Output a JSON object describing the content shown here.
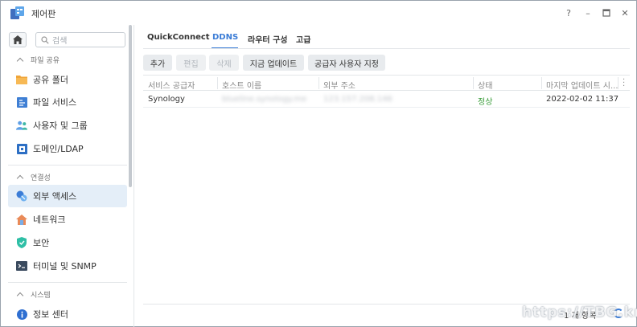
{
  "window": {
    "title": "제어판",
    "controls": {
      "help": "?",
      "minimize": "–",
      "maximize": "□",
      "close": "✕"
    }
  },
  "sidebar": {
    "search_placeholder": "검색",
    "sections": [
      {
        "label": "파일 공유",
        "items": [
          {
            "label": "공유 폴더",
            "icon": "shared-folder-icon"
          },
          {
            "label": "파일 서비스",
            "icon": "file-services-icon"
          },
          {
            "label": "사용자 및 그룹",
            "icon": "user-group-icon"
          },
          {
            "label": "도메인/LDAP",
            "icon": "domain-ldap-icon"
          }
        ]
      },
      {
        "label": "연결성",
        "items": [
          {
            "label": "외부 액세스",
            "icon": "external-access-icon",
            "active": true
          },
          {
            "label": "네트워크",
            "icon": "network-icon"
          },
          {
            "label": "보안",
            "icon": "security-shield-icon"
          },
          {
            "label": "터미널 및 SNMP",
            "icon": "terminal-icon"
          }
        ]
      },
      {
        "label": "시스템",
        "items": [
          {
            "label": "정보 센터",
            "icon": "info-center-icon"
          }
        ]
      }
    ]
  },
  "tabs": [
    {
      "label": "QuickConnect"
    },
    {
      "label": "DDNS",
      "active": true
    },
    {
      "label": "라우터 구성"
    },
    {
      "label": "고급"
    }
  ],
  "toolbar": {
    "add": "추가",
    "edit": "편집",
    "delete": "삭제",
    "update_now": "지금 업데이트",
    "custom_provider": "공급자 사용자 지정"
  },
  "table": {
    "headers": [
      "서비스 공급자",
      "호스트 이름",
      "외부 주소",
      "상태",
      "마지막 업데이트 시..."
    ],
    "rows": [
      [
        "Synology",
        "blueline.synology.me",
        "123.157.208.146",
        "정상",
        "2022-02-02 11:37"
      ]
    ]
  },
  "footer": {
    "count": "1 개 항목"
  },
  "watermark": "https://TBG.kr",
  "colors": {
    "accent": "#3b7cd6",
    "ok": "#3a9d3a"
  }
}
